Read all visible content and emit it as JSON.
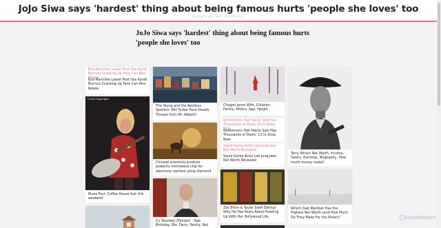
{
  "header": {
    "title": "JoJo Siwa says 'hardest' thing about being famous hurts 'people she loves' too",
    "subtitle": "Inspiration Gallery"
  },
  "article": {
    "title": "JoJo Siwa says 'hardest' thing about being famous hurts 'people she loves' too"
  },
  "cards": [
    {
      "alt": "Eva Marcillee Latest Post Has Kandi Burruss Cracking Up Fans Can Also Relate",
      "caption": "Eva Marcillee Latest Post Has Kandi Burruss Cracking Up Fans Can Also Relate"
    },
    {
      "caption": "Blues Fest, Coffee House fest this weekend",
      "copyright": "© 2021 Royal Open"
    },
    {
      "caption": "The Young and the Restless Spoilers: Will Turker Face Deadly Threats from Mr. Abbott?"
    },
    {
      "caption": "Chinese scientists produce powerful microwave chip for electronic warfare using diamond"
    },
    {
      "caption": "Cy Twombly (Painter) - Age, Birthday, Bio, Facts, Family, Net Worth, Height &"
    },
    {
      "caption": "Chippei Jones Wife, Children, Family, Affairs, Age, Height"
    },
    {
      "alt": "Nordstroms Half Yearly Sale Has Thousands of Deals 13 to Shop Now",
      "caption": "Nordstroms Half Yearly Sale Has Thousands of Deals: 13 to Shop Now"
    },
    {
      "alt": "Squid Game Actor Lee Jung-jaes Net Worth Revealed",
      "caption": "Squid Game Actor Lee Jung-jaes Net Worth Revealed"
    },
    {
      "caption": "Zac Efron & Taylor Swift Dating? Why He Has Fears About Hooking Up With Her Hollywood Life"
    },
    {
      "caption": "Terry Wilson Net Worth, Income, Salary, Earnings, Biography, How much money make?"
    },
    {
      "caption": "Which Cast Member Has the Highest Net Worth (and How Much Do They Make For the Show)?"
    }
  ],
  "watermark": {
    "text": "ScanMalware"
  },
  "colors": {
    "accent": "#e2739a",
    "background": "#f2f2f2"
  }
}
